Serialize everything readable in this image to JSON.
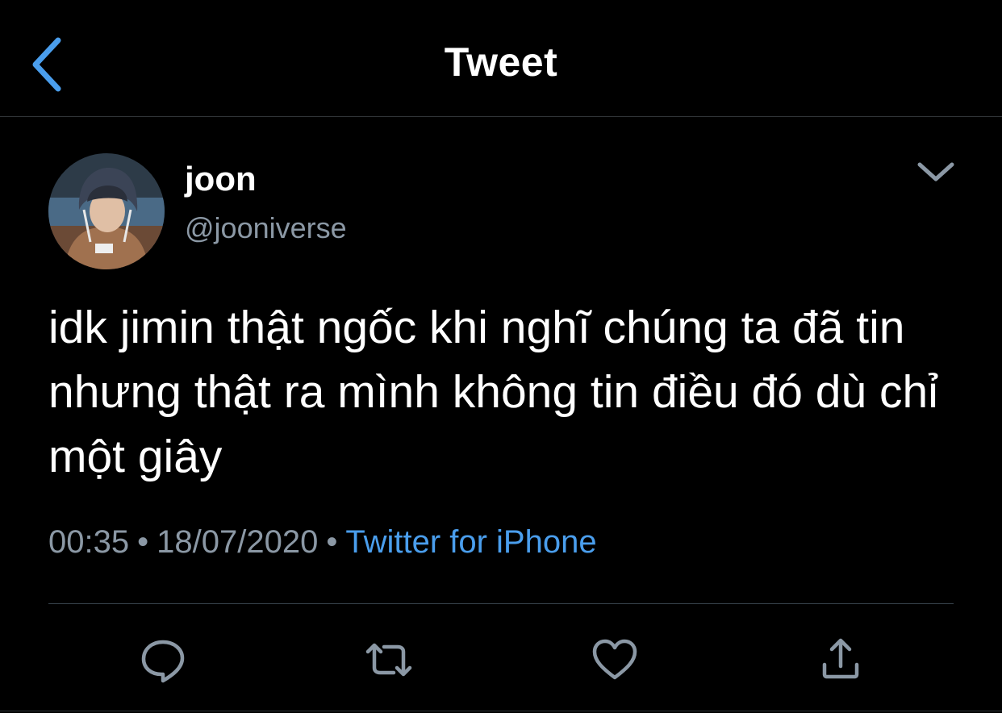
{
  "header": {
    "title": "Tweet",
    "back_icon": "chevron-left-icon"
  },
  "colors": {
    "background": "#000000",
    "text": "#ffffff",
    "muted": "#8b98a5",
    "link": "#4a9eed",
    "back_accent": "#4a9eed"
  },
  "tweet": {
    "author": {
      "name": "joon",
      "handle": "@jooniverse"
    },
    "text": "idk jimin thật ngốc khi nghĩ chúng ta đã tin nhưng thật ra mình không tin điều đó dù chỉ một giây",
    "time": "00:35",
    "date": "18/07/2020",
    "separator": "•",
    "source": "Twitter for iPhone"
  },
  "actions": [
    {
      "name": "reply",
      "icon": "reply-icon"
    },
    {
      "name": "retweet",
      "icon": "retweet-icon"
    },
    {
      "name": "like",
      "icon": "heart-icon"
    },
    {
      "name": "share",
      "icon": "share-icon"
    }
  ]
}
